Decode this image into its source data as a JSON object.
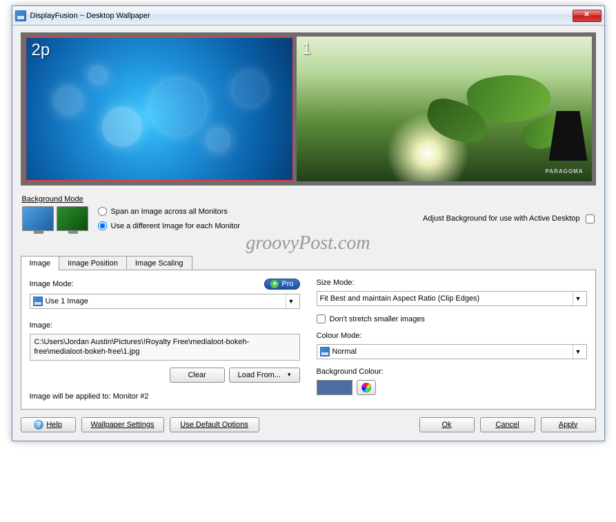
{
  "window": {
    "title": "DisplayFusion ~ Desktop Wallpaper"
  },
  "monitors": [
    {
      "id": 1,
      "label": "2p"
    },
    {
      "id": 2,
      "label": "1",
      "brand": "PARAGOMA"
    }
  ],
  "background_mode": {
    "group_label": "Background Mode",
    "opt_span": "Span an Image across all Monitors",
    "opt_diff": "Use a different Image for each Monitor",
    "adjust_label": "Adjust Background for use with Active Desktop"
  },
  "watermark": "groovyPost.com",
  "tabs": {
    "image": "Image",
    "position": "Image Position",
    "scaling": "Image Scaling"
  },
  "image_tab": {
    "image_mode_label": "Image Mode:",
    "image_mode_value": "Use 1 Image",
    "pro_label": "Pro",
    "image_label": "Image:",
    "image_path": "C:\\Users\\Jordan Austin\\Pictures\\!Royalty Free\\medialoot-bokeh-free\\medialoot-bokeh-free\\1.jpg",
    "clear_btn": "Clear",
    "load_btn": "Load From...",
    "applied_note": "Image will be applied to: Monitor #2",
    "size_mode_label": "Size Mode:",
    "size_mode_value": "Fit Best and maintain Aspect Ratio (Clip Edges)",
    "dont_stretch": "Don't stretch smaller images",
    "colour_mode_label": "Colour Mode:",
    "colour_mode_value": "Normal",
    "bg_colour_label": "Background Colour:",
    "bg_colour_value": "#4a6ea0"
  },
  "footer": {
    "help": "Help",
    "wallpaper_settings": "Wallpaper Settings",
    "use_default": "Use Default Options",
    "ok": "Ok",
    "cancel": "Cancel",
    "apply": "Apply"
  }
}
